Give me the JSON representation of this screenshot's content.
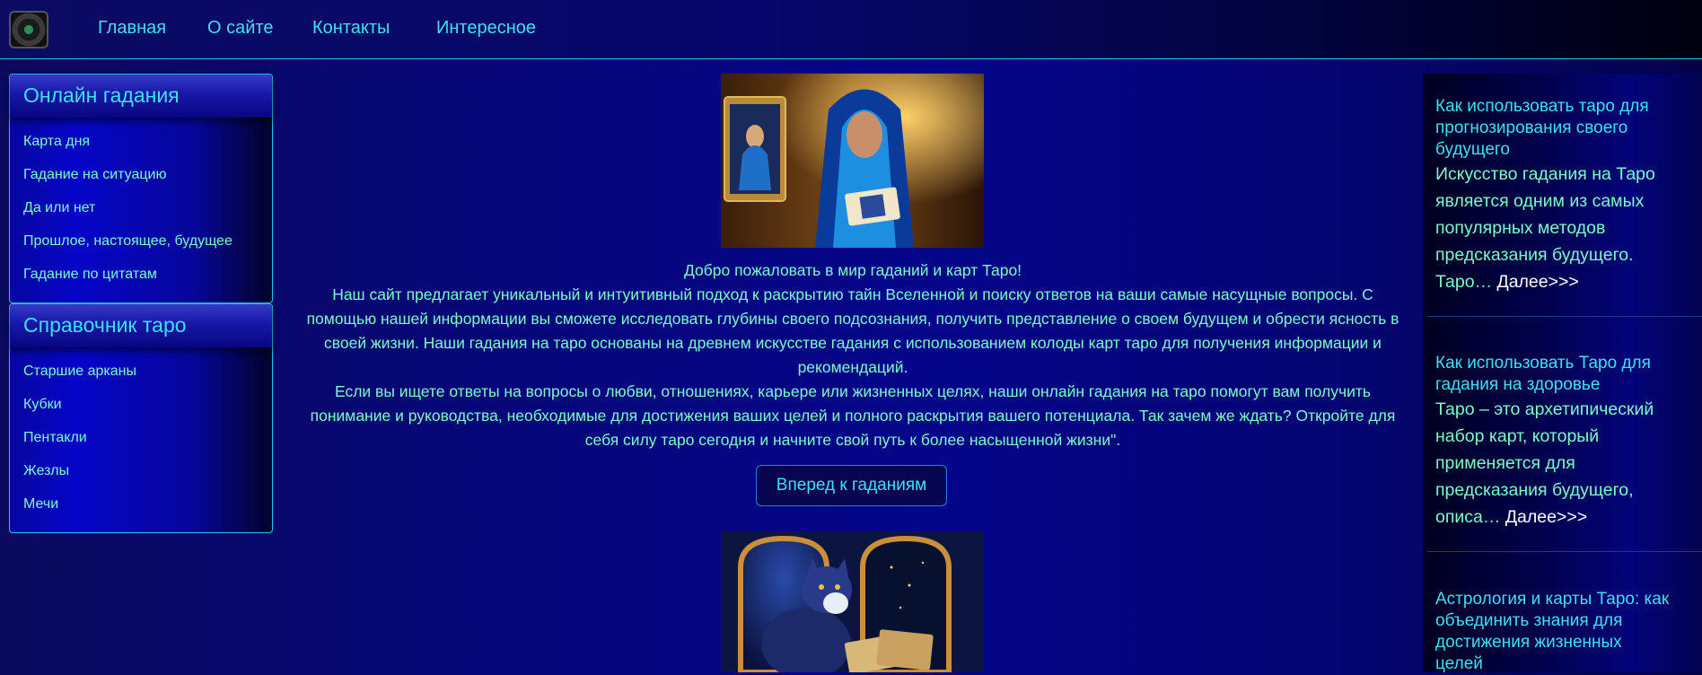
{
  "header": {
    "logo_icon": "tarot-cube-logo-icon",
    "nav": [
      "Главная",
      "О сайте",
      "Контакты",
      "Интересное"
    ]
  },
  "sidebar": {
    "sections": [
      {
        "title": "Онлайн гадания",
        "items": [
          "Карта дня",
          "Гадание на ситуацию",
          "Да или нет",
          "Прошлое, настоящее, будущее",
          "Гадание по цитатам"
        ]
      },
      {
        "title": "Справочник таро",
        "items": [
          "Старшие арканы",
          "Кубки",
          "Пентакли",
          "Жезлы",
          "Мечи"
        ]
      }
    ]
  },
  "main": {
    "hero_image_icon": "woman-reading-tarot-image",
    "welcome": "Добро пожаловать в мир гаданий и карт Таро!",
    "para1": "Наш сайт предлагает уникальный и интуитивный подход к раскрытию тайн Вселенной и поиску ответов на ваши самые насущные вопросы. С помощью нашей информации вы сможете исследовать глубины своего подсознания, получить представление о своем будущем и обрести ясность в своей жизни. Наши гадания на таро основаны на древнем искусстве гадания с использованием колоды карт таро для получения информации и рекомендаций.",
    "para2": "Если вы ищете ответы на вопросы о любви, отношениях, карьере или жизненных целях, наши онлайн гадания на таро помогут вам получить понимание и руководства, необходимые для достижения ваших целей и полного раскрытия вашего потенциала. Так зачем же ждать? Откройте для себя силу таро сегодня и начните свой путь к более насыщенной жизни\".",
    "cta": "Вперед к гаданиям",
    "second_image_icon": "cat-with-tarot-cards-image"
  },
  "articles": [
    {
      "title": "Как использовать таро для прогнозирования своего будущего",
      "body": "Искусство гадания на Таро является одним из самых популярных методов предсказания будущего. Таро… ",
      "more": "Далее>>>"
    },
    {
      "title": "Как использовать Таро для гадания на здоровье",
      "body": "Таро – это архетипический набор карт, который применяется для предсказания будущего, описа… ",
      "more": "Далее>>>"
    },
    {
      "title": "Астрология и карты Таро: как объединить знания для достижения жизненных целей",
      "body": "",
      "more": ""
    }
  ],
  "colors": {
    "accent_cyan": "#3ee0f0",
    "text_green": "#7dfcc8",
    "border": "#24c4e8"
  }
}
